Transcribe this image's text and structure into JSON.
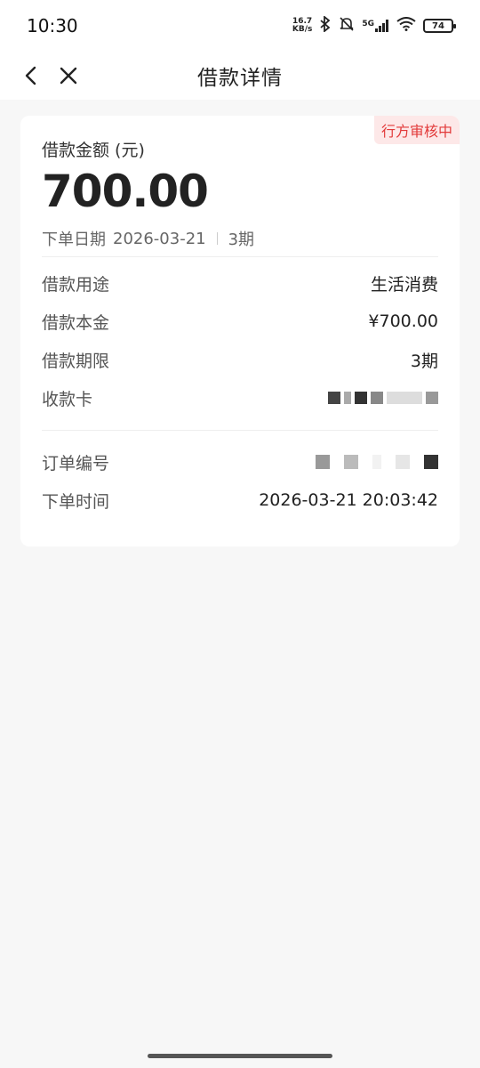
{
  "status_bar": {
    "time": "10:30",
    "speed_value": "16.7",
    "speed_unit": "KB/s",
    "network": "5G",
    "battery": "74"
  },
  "nav": {
    "title": "借款详情"
  },
  "loan": {
    "status_badge": "行方审核中",
    "amount_label": "借款金额 (元)",
    "amount": "700.00",
    "order_date_label": "下单日期",
    "order_date": "2026-03-21",
    "term_short": "3期"
  },
  "details": [
    {
      "label": "借款用途",
      "value": "生活消费"
    },
    {
      "label": "借款本金",
      "value": "¥700.00"
    },
    {
      "label": "借款期限",
      "value": "3期"
    },
    {
      "label": "收款卡",
      "value": ""
    }
  ],
  "order": [
    {
      "label": "订单编号",
      "value": ""
    },
    {
      "label": "下单时间",
      "value": "2026-03-21 20:03:42"
    }
  ]
}
